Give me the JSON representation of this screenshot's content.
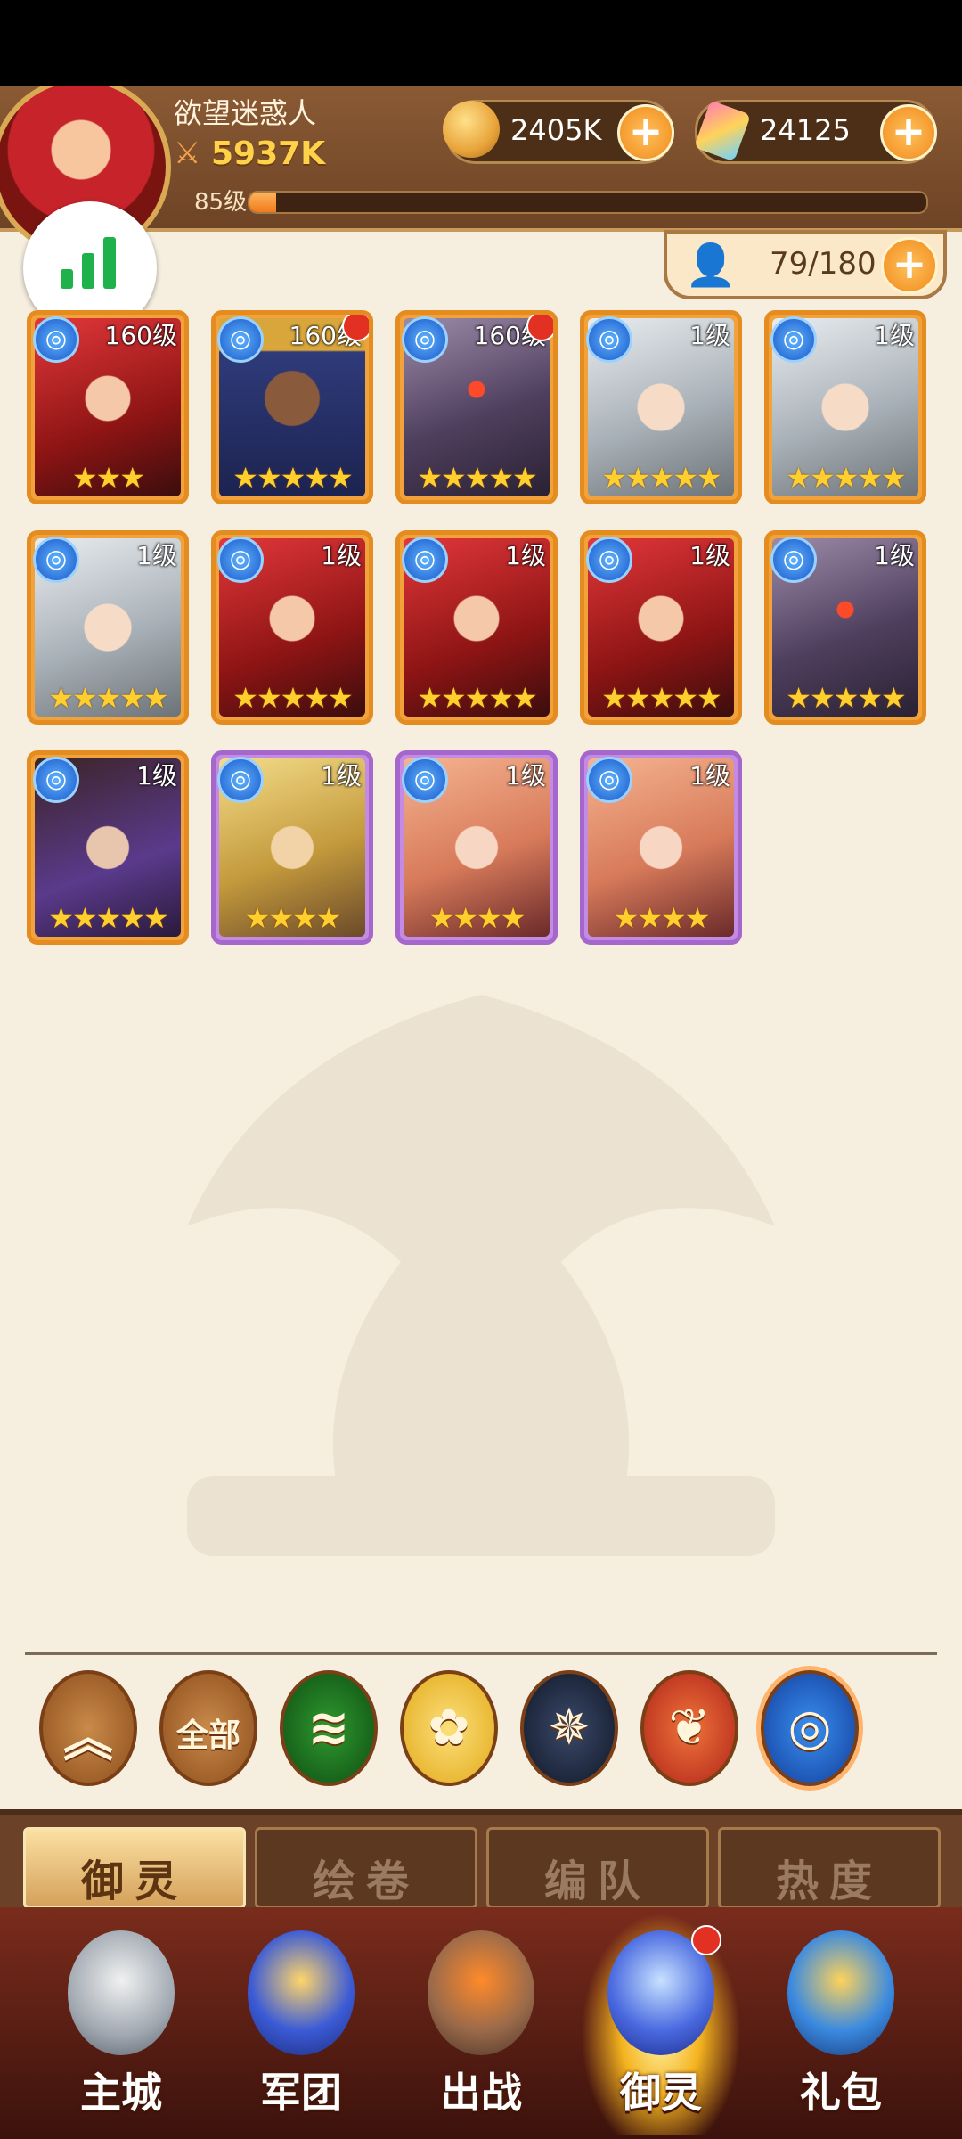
{
  "player": {
    "name": "欲望迷惑人",
    "power": "5937K",
    "level": "85级",
    "xp_fraction": 0.04
  },
  "resources": {
    "gold": "2405K",
    "gems": "24125"
  },
  "members": {
    "count": "79/180"
  },
  "cards": [
    {
      "level": "160级",
      "stars": 3,
      "rarity": "orange",
      "red_dot": false,
      "art": "red-hair-woman"
    },
    {
      "level": "160级",
      "stars": 5,
      "rarity": "orange",
      "red_dot": true,
      "art": "dark-skin-crowned"
    },
    {
      "level": "160级",
      "stars": 5,
      "rarity": "orange",
      "red_dot": true,
      "art": "armored-demon"
    },
    {
      "level": "1级",
      "stars": 5,
      "rarity": "orange",
      "red_dot": false,
      "art": "silver-hair-man"
    },
    {
      "level": "1级",
      "stars": 5,
      "rarity": "orange",
      "red_dot": false,
      "art": "silver-hair-man"
    },
    {
      "level": "1级",
      "stars": 5,
      "rarity": "orange",
      "red_dot": false,
      "art": "silver-hair-man"
    },
    {
      "level": "1级",
      "stars": 5,
      "rarity": "orange",
      "red_dot": false,
      "art": "red-hair-woman"
    },
    {
      "level": "1级",
      "stars": 5,
      "rarity": "orange",
      "red_dot": false,
      "art": "red-hair-woman"
    },
    {
      "level": "1级",
      "stars": 5,
      "rarity": "orange",
      "red_dot": false,
      "art": "red-hair-woman"
    },
    {
      "level": "1级",
      "stars": 5,
      "rarity": "orange",
      "red_dot": false,
      "art": "armored-demon"
    },
    {
      "level": "1级",
      "stars": 5,
      "rarity": "orange",
      "red_dot": false,
      "art": "dark-hair-man"
    },
    {
      "level": "1级",
      "stars": 4,
      "rarity": "purple",
      "red_dot": false,
      "art": "blonde-man"
    },
    {
      "level": "1级",
      "stars": 4,
      "rarity": "purple",
      "red_dot": false,
      "art": "peach-hair-woman"
    },
    {
      "level": "1级",
      "stars": 4,
      "rarity": "purple",
      "red_dot": false,
      "art": "peach-hair-woman"
    }
  ],
  "filters": [
    {
      "name": "collapse-filter-button",
      "label": "",
      "icon": "double-chevron-up-icon"
    },
    {
      "name": "all-filter-button",
      "label": "全部",
      "icon": ""
    },
    {
      "name": "wind-element-filter-button",
      "label": "",
      "icon": "wind-icon"
    },
    {
      "name": "light-element-filter-button",
      "label": "",
      "icon": "rose-icon"
    },
    {
      "name": "dark-element-filter-button",
      "label": "",
      "icon": "star-emblem-icon"
    },
    {
      "name": "fire-element-filter-button",
      "label": "",
      "icon": "phoenix-icon"
    },
    {
      "name": "water-element-filter-button",
      "label": "",
      "icon": "water-swirl-icon"
    }
  ],
  "tabs": [
    {
      "label": "御灵",
      "active": true
    },
    {
      "label": "绘卷",
      "active": false
    },
    {
      "label": "编队",
      "active": false
    },
    {
      "label": "热度",
      "active": false
    }
  ],
  "nav": [
    {
      "label": "主城",
      "icon": "angel-statue-icon",
      "active": false,
      "red_dot": false
    },
    {
      "label": "军团",
      "icon": "fist-shield-icon",
      "active": false,
      "red_dot": false
    },
    {
      "label": "出战",
      "icon": "gate-sword-icon",
      "active": false,
      "red_dot": false
    },
    {
      "label": "御灵",
      "icon": "crystal-icon",
      "active": true,
      "red_dot": true
    },
    {
      "label": "礼包",
      "icon": "shop-stall-icon",
      "active": false,
      "red_dot": false
    }
  ],
  "colors": {
    "accent": "#f08a1b",
    "orange_rarity": "#f2a23a",
    "purple_rarity": "#c48be4",
    "background": "#f6efe0"
  }
}
